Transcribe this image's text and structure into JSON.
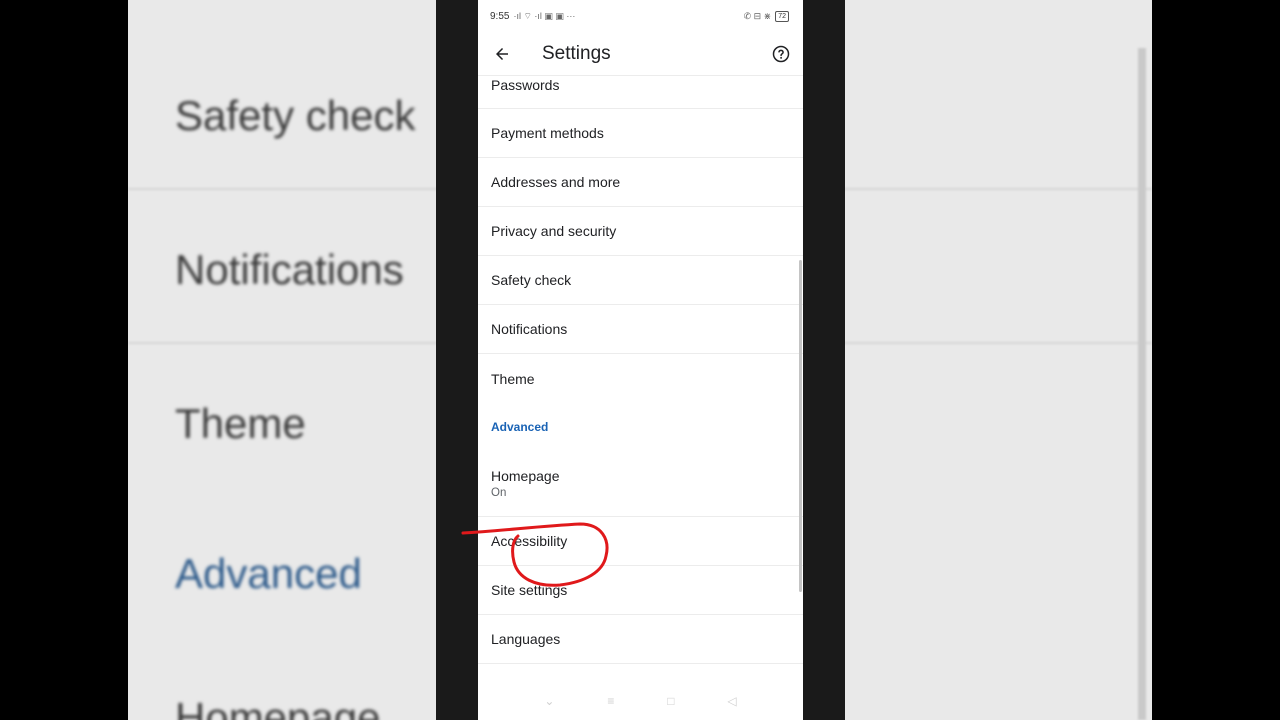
{
  "status_bar": {
    "time": "9:55",
    "left_glyphs": "·ıl ⌔ ·ıl ▣ ▣ ···",
    "right_glyphs": "✆ ⊟ ⋇",
    "battery": "72"
  },
  "app_bar": {
    "title": "Settings",
    "back_icon": "arrow-left-icon",
    "help_icon": "help-circle-icon"
  },
  "items": {
    "passwords": "Passwords",
    "payment_methods": "Payment methods",
    "addresses": "Addresses and more",
    "privacy": "Privacy and security",
    "safety_check": "Safety check",
    "notifications": "Notifications",
    "theme": "Theme",
    "advanced_header": "Advanced",
    "homepage": "Homepage",
    "homepage_status": "On",
    "accessibility": "Accessibility",
    "site_settings": "Site settings",
    "languages": "Languages"
  },
  "background_blur": {
    "t1": "Safety check",
    "t2": "Notifications",
    "t3": "Theme",
    "t4": "Advanced",
    "t5": "Homepage"
  },
  "nav_bar": {
    "menu": "⌄",
    "recents": "≡",
    "home": "□",
    "back": "◁"
  },
  "colors": {
    "accent": "#1a63b5",
    "annotation": "#e0191b"
  }
}
